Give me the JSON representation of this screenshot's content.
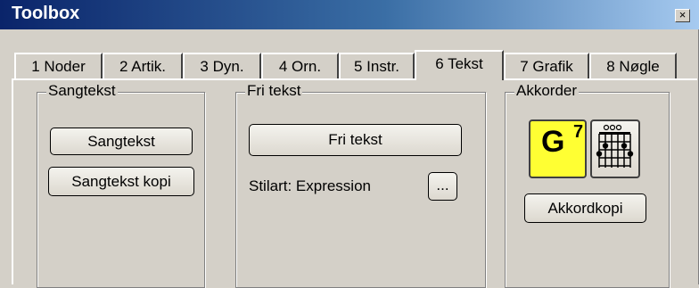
{
  "window": {
    "title": "Toolbox",
    "close_glyph": "×"
  },
  "tabs": [
    {
      "label": "1 Noder"
    },
    {
      "label": "2 Artik."
    },
    {
      "label": "3 Dyn."
    },
    {
      "label": "4 Orn."
    },
    {
      "label": "5 Instr."
    },
    {
      "label": "6 Tekst",
      "active": true
    },
    {
      "label": "7 Grafik"
    },
    {
      "label": "8 Nøgle"
    }
  ],
  "groups": {
    "sangtekst": {
      "title": "Sangtekst",
      "button1": "Sangtekst",
      "button2": "Sangtekst kopi"
    },
    "fritekst": {
      "title": "Fri tekst",
      "button": "Fri tekst",
      "style_label": "Stilart: Expression",
      "browse_button": "..."
    },
    "akkorder": {
      "title": "Akkorder",
      "chord_letter": "G",
      "chord_superscript": "7",
      "chord_diagram_icon": "chord-diagram-icon",
      "copy_button": "Akkordkopi"
    }
  },
  "colors": {
    "chord_icon_bg": "#ffff33",
    "titlebar_start": "#0a246a",
    "titlebar_end": "#a6caf0"
  }
}
